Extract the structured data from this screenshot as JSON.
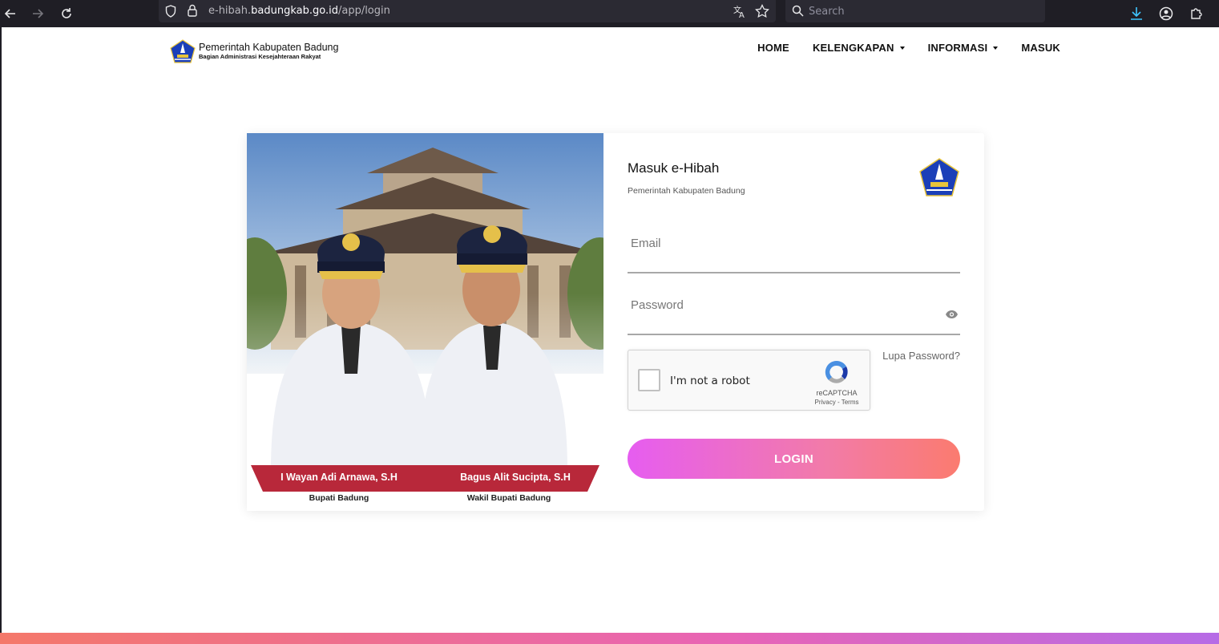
{
  "browser": {
    "url_prefix": "e-hibah.",
    "url_domain": "badungkab.go.id",
    "url_path": "/app/login",
    "search_placeholder": "Search"
  },
  "header": {
    "brand_title": "Pemerintah Kabupaten Badung",
    "brand_subtitle": "Bagian Administrasi Kesejahteraan Rakyat",
    "menu": [
      {
        "label": "HOME",
        "dropdown": false
      },
      {
        "label": "KELENGKAPAN",
        "dropdown": true
      },
      {
        "label": "INFORMASI",
        "dropdown": true
      },
      {
        "label": "MASUK",
        "dropdown": false
      }
    ]
  },
  "photo": {
    "person1_name": "I Wayan Adi Arnawa, S.H",
    "person1_role": "Bupati Badung",
    "person2_name": "Bagus Alit Sucipta, S.H",
    "person2_role": "Wakil Bupati Badung"
  },
  "form": {
    "title": "Masuk e-Hibah",
    "subtitle": "Pemerintah Kabupaten Badung",
    "email_placeholder": "Email",
    "password_placeholder": "Password",
    "captcha_label": "I'm not a robot",
    "captcha_brand": "reCAPTCHA",
    "captcha_terms": "Privacy - Terms",
    "forgot_label": "Lupa Password?",
    "login_label": "LOGIN"
  },
  "colors": {
    "brand_blue": "#1b3fb8",
    "banner_red": "#b8283a",
    "login_gradient_start": "#e65df0",
    "login_gradient_end": "#fb7b6f"
  }
}
